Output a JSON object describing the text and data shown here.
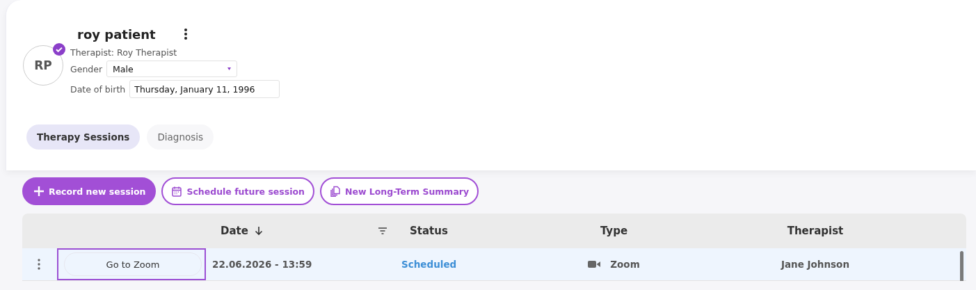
{
  "patient": {
    "initials": "RP",
    "verified": true,
    "name": "roy patient",
    "therapist": "Therapist: Roy Therapist",
    "gender_label": "Gender",
    "gender": "Male",
    "dob_label": "Date of birth",
    "dob": "Thursday, January 11, 1996"
  },
  "tabs": [
    {
      "label": "Therapy Sessions",
      "selected": true
    },
    {
      "label": "Diagnosis",
      "selected": false
    }
  ],
  "actions": [
    {
      "label": "Record new session",
      "kind": "primary"
    },
    {
      "label": "Schedule future session",
      "kind": "calendar"
    },
    {
      "label": "New Long-Term Summary",
      "kind": "copy"
    }
  ],
  "table": {
    "columns": [
      {
        "label": "Date",
        "sorted": true,
        "filter": true
      },
      {
        "label": "Status"
      },
      {
        "label": "Type"
      },
      {
        "label": "Therapist"
      }
    ],
    "rows": [
      {
        "selected": true,
        "focused": true,
        "link": "Go to Zoom",
        "date": "22.06.2026 - 13:59",
        "status": "Scheduled",
        "type": "Zoom",
        "therapist": "Jane Johnson"
      }
    ]
  }
}
